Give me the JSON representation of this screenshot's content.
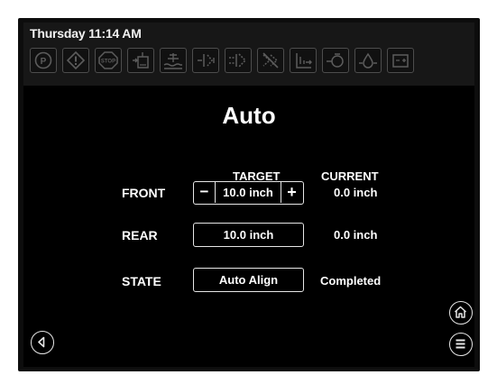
{
  "header": {
    "datetime": "Thursday 11:14 AM",
    "indicators": [
      {
        "name": "parking-brake-icon",
        "glyph": "(P)"
      },
      {
        "name": "warning-icon",
        "glyph": "!"
      },
      {
        "name": "stop-icon",
        "glyph": "STOP"
      },
      {
        "name": "jack-down-icon"
      },
      {
        "name": "level-ground-icon"
      },
      {
        "name": "front-jack-icon"
      },
      {
        "name": "rear-jack-icon"
      },
      {
        "name": "jack-fault-icon"
      },
      {
        "name": "stairs-icon"
      },
      {
        "name": "pump-icon"
      },
      {
        "name": "oil-pressure-icon"
      },
      {
        "name": "battery-icon"
      }
    ]
  },
  "main": {
    "title": "Auto",
    "columns": {
      "target": "TARGET",
      "current": "CURRENT"
    },
    "rows": {
      "front": {
        "label": "FRONT",
        "minus": "−",
        "target": "10.0 inch",
        "plus": "+",
        "current": "0.0 inch"
      },
      "rear": {
        "label": "REAR",
        "target": "10.0 inch",
        "current": "0.0 inch"
      },
      "state": {
        "label": "STATE",
        "action": "Auto Align",
        "status": "Completed"
      }
    }
  },
  "colors": {
    "background": "#000000",
    "topbar": "#171717",
    "text": "#ffffff",
    "indicator_border": "#4d4d4d"
  }
}
